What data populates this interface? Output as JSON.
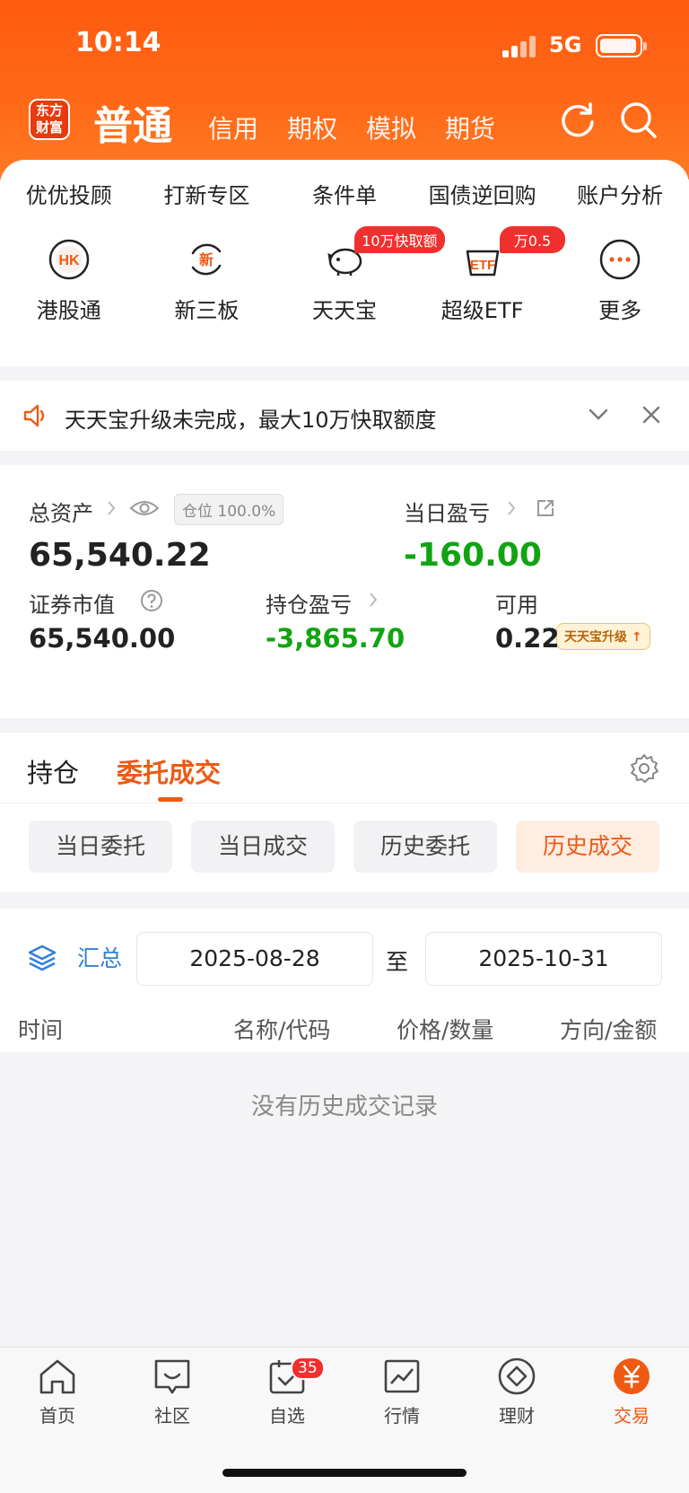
{
  "status": {
    "time": "10:14",
    "network": "5G"
  },
  "header": {
    "logo_line1": "东方",
    "logo_line2": "财富",
    "title": "普通",
    "tabs": [
      "信用",
      "期权",
      "模拟",
      "期货"
    ]
  },
  "features_row1": [
    "优优投顾",
    "打新专区",
    "条件单",
    "国债逆回购",
    "账户分析"
  ],
  "features_row2": [
    {
      "label": "港股通",
      "icon_text": "HK",
      "badge": ""
    },
    {
      "label": "新三板",
      "icon_text": "新",
      "badge": ""
    },
    {
      "label": "天天宝",
      "icon_text": "",
      "badge": "10万快取额"
    },
    {
      "label": "超级ETF",
      "icon_text": "ETF",
      "badge": "万0.5"
    },
    {
      "label": "更多",
      "icon_text": "···",
      "badge": ""
    }
  ],
  "notice": {
    "text": "天天宝升级未完成，最大10万快取额度"
  },
  "assets": {
    "total_label": "总资产",
    "position_tag": "仓位 100.0%",
    "total_value": "65,540.22",
    "daily_label": "当日盈亏",
    "daily_value": "-160.00",
    "market_label": "证券市值",
    "market_value": "65,540.00",
    "hold_label": "持仓盈亏",
    "hold_value": "-3,865.70",
    "available_label": "可用",
    "available_value": "0.22",
    "upgrade_tag": "天天宝升级"
  },
  "tabs": {
    "holdings": "持仓",
    "orders": "委托成交",
    "sub": [
      "当日委托",
      "当日成交",
      "历史委托",
      "历史成交"
    ]
  },
  "filter": {
    "summary": "汇总",
    "start_date": "2025-08-28",
    "to": "至",
    "end_date": "2025-10-31"
  },
  "table": {
    "columns": [
      "时间",
      "名称/代码",
      "价格/数量",
      "方向/金额"
    ]
  },
  "empty_text": "没有历史成交记录",
  "bottom_nav": [
    {
      "label": "首页"
    },
    {
      "label": "社区"
    },
    {
      "label": "自选",
      "badge": "35"
    },
    {
      "label": "行情"
    },
    {
      "label": "理财"
    },
    {
      "label": "交易"
    }
  ],
  "colors": {
    "brand": "#ee5a14",
    "gain_down": "#12a312",
    "badge_red": "#f0302e"
  }
}
